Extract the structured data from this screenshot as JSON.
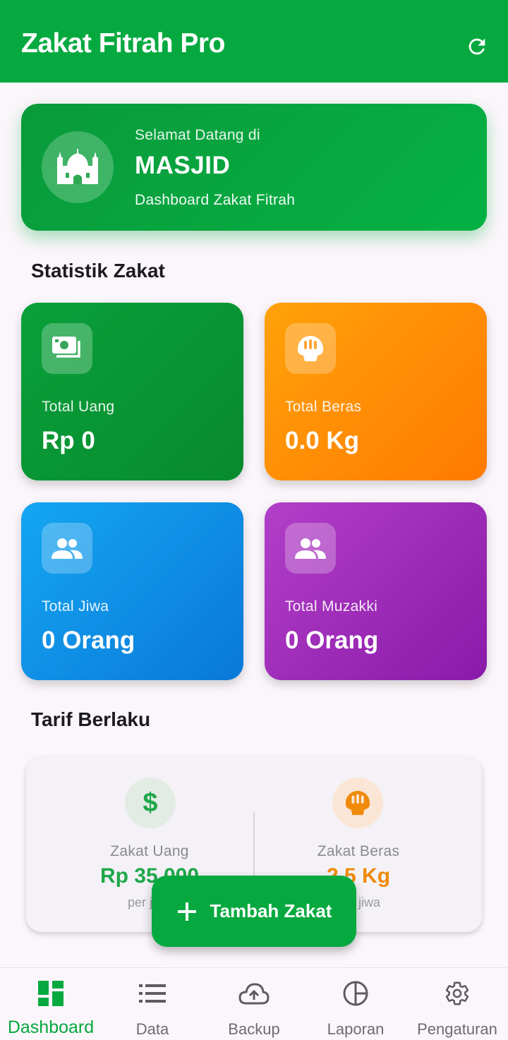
{
  "app_bar": {
    "title": "Zakat Fitrah Pro",
    "refresh_icon": "refresh-icon"
  },
  "welcome": {
    "greeting": "Selamat Datang di",
    "name": "MASJID",
    "subtitle": "Dashboard Zakat Fitrah",
    "icon": "mosque-icon"
  },
  "statistik": {
    "title": "Statistik Zakat",
    "cards": [
      {
        "label": "Total Uang",
        "value": "Rp 0",
        "icon": "money-icon",
        "color": "#0a9a38"
      },
      {
        "label": "Total Beras",
        "value": "0.0 Kg",
        "icon": "rice-bowl-icon",
        "color": "#ff8c00"
      },
      {
        "label": "Total Jiwa",
        "value": "0 Orang",
        "icon": "people-icon",
        "color": "#0f8fe6"
      },
      {
        "label": "Total Muzakki",
        "value": "0 Orang",
        "icon": "people-icon",
        "color": "#9c27b0"
      }
    ]
  },
  "tarif": {
    "title": "Tarif Berlaku",
    "uang": {
      "label": "Zakat Uang",
      "value": "Rp 35.000",
      "unit": "per jiwa",
      "icon": "dollar-icon"
    },
    "beras": {
      "label": "Zakat Beras",
      "value": "2.5 Kg",
      "unit": "per jiwa",
      "icon": "rice-bowl-icon"
    }
  },
  "fab": {
    "label": "Tambah Zakat",
    "icon": "plus-icon"
  },
  "bottom_nav": {
    "active": "Dashboard",
    "items": [
      {
        "label": "Dashboard",
        "icon": "dashboard-icon"
      },
      {
        "label": "Data",
        "icon": "list-icon"
      },
      {
        "label": "Backup",
        "icon": "cloud-upload-icon"
      },
      {
        "label": "Laporan",
        "icon": "pie-chart-icon"
      },
      {
        "label": "Pengaturan",
        "icon": "gear-icon"
      }
    ]
  },
  "colors": {
    "primary": "#05a93f",
    "background": "#fbf6fb",
    "uang_accent": "#1fa84a",
    "beras_accent": "#f08a09"
  }
}
